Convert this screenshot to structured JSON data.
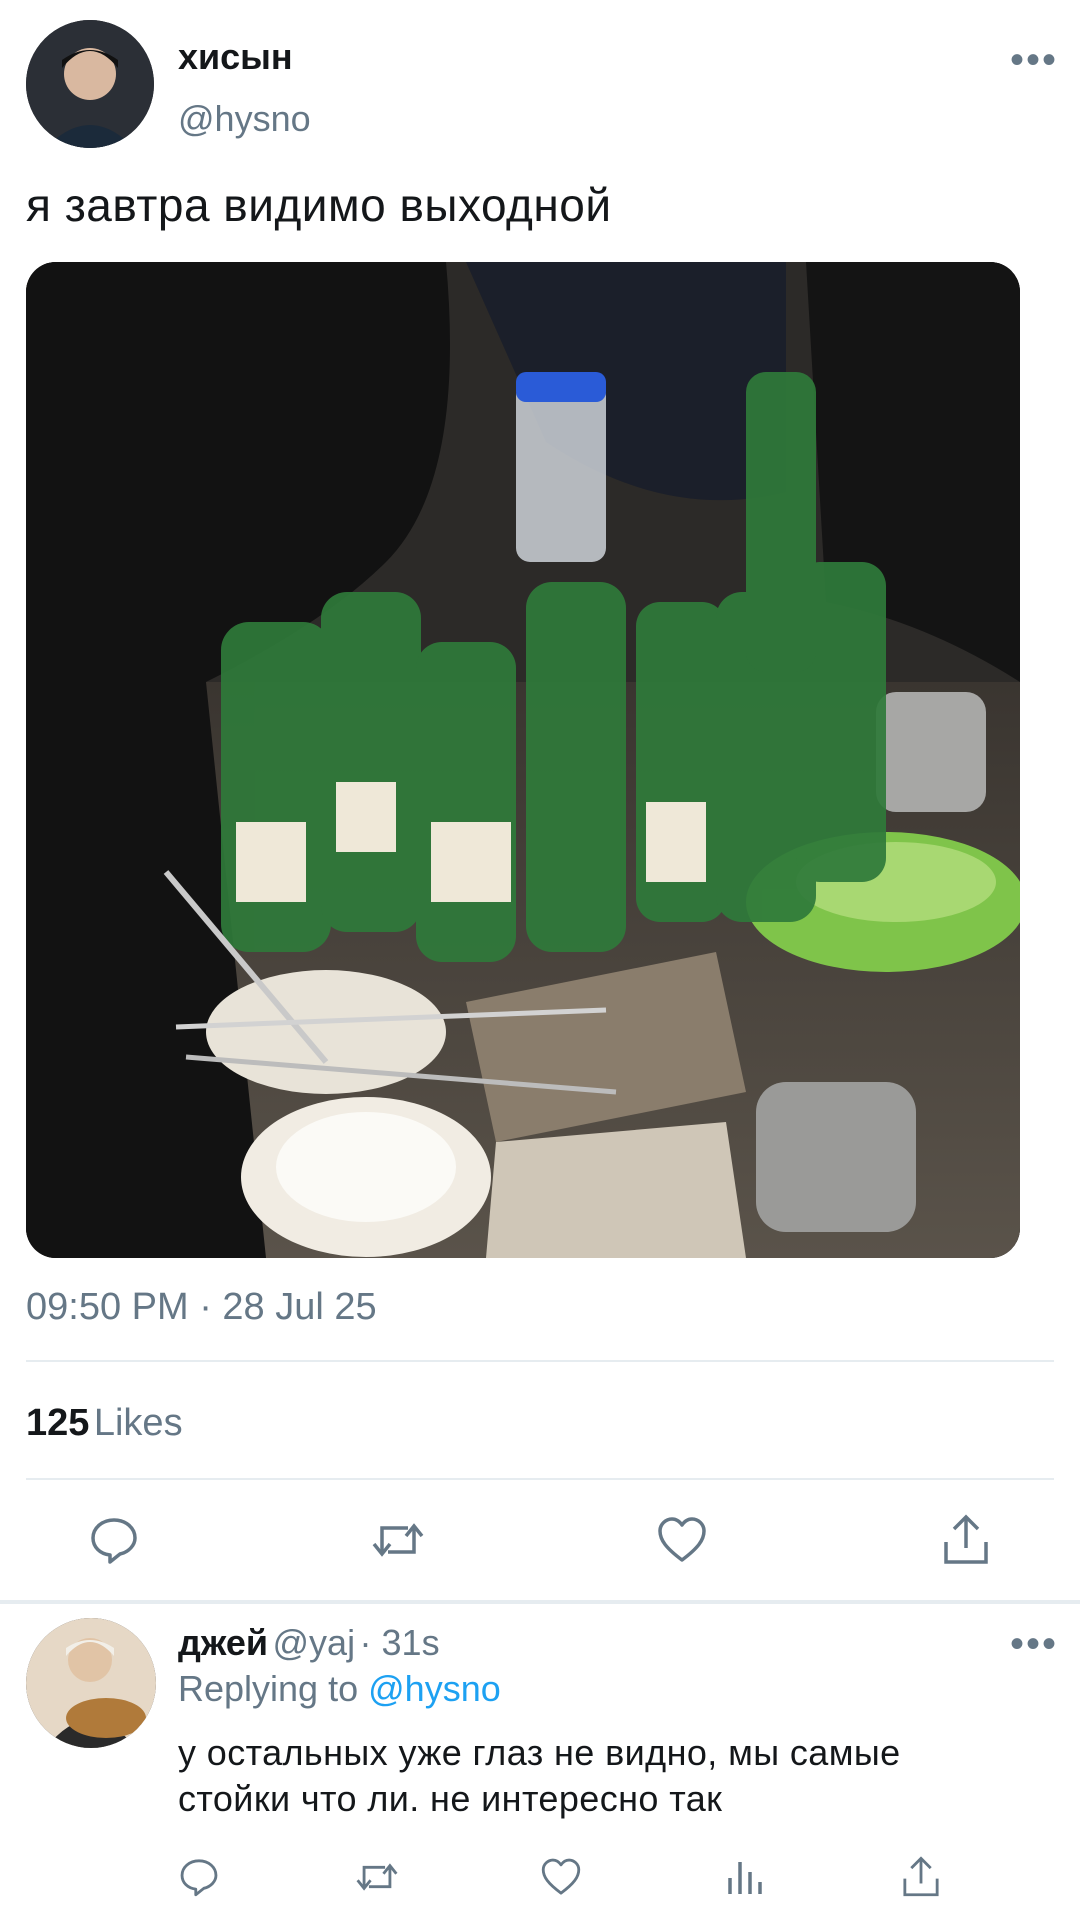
{
  "tweet": {
    "author_name": "хисын",
    "author_handle": "@hysno",
    "text": "я завтра видимо выходной",
    "timestamp": "09:50 PM · 28 Jul 25",
    "likes_count": "125",
    "likes_label": "Likes"
  },
  "actions": {
    "icons": [
      "reply-icon",
      "retweet-icon",
      "like-icon",
      "share-icon"
    ]
  },
  "reply": {
    "author_name": "джей",
    "author_handle": "@yaj",
    "time": "· 31s",
    "replying_prefix": "Replying to",
    "replying_handle": "@hysno",
    "text_line1": "у остальных уже глаз не видно, мы самые",
    "text_line2": "стойки что ли. не интересно так",
    "icons": [
      "reply-icon",
      "retweet-icon",
      "like-icon",
      "analytics-icon",
      "share-icon"
    ]
  },
  "colors": {
    "link": "#1da1f2",
    "muted": "#657786",
    "divider": "#e6ecf0"
  }
}
